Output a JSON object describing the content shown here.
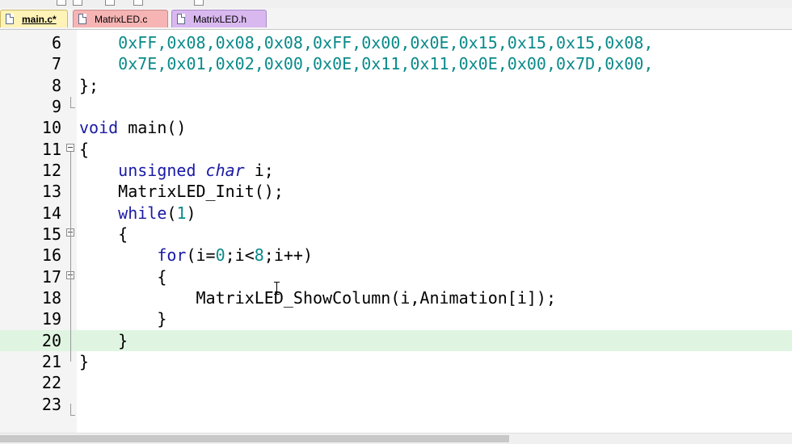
{
  "tabs": [
    {
      "label": "main.c*",
      "active": true,
      "color": "#fff3b8"
    },
    {
      "label": "MatrixLED.c",
      "active": false,
      "color": "#f6b4b4"
    },
    {
      "label": "MatrixLED.h",
      "active": false,
      "color": "#d9b8f0"
    }
  ],
  "editor": {
    "current_line": 20,
    "lines": [
      {
        "num": "6",
        "text": "    0xFF,0x08,0x08,0x08,0xFF,0x00,0x0E,0x15,0x15,0x15,0x08,"
      },
      {
        "num": "7",
        "text": "    0x7E,0x01,0x02,0x00,0x0E,0x11,0x11,0x0E,0x00,0x7D,0x00,"
      },
      {
        "num": "8",
        "text": "};"
      },
      {
        "num": "9",
        "text": ""
      },
      {
        "num": "10",
        "text": "void main()"
      },
      {
        "num": "11",
        "text": "{"
      },
      {
        "num": "12",
        "text": "    unsigned char i;"
      },
      {
        "num": "13",
        "text": "    MatrixLED_Init();"
      },
      {
        "num": "14",
        "text": "    while(1)"
      },
      {
        "num": "15",
        "text": "    {"
      },
      {
        "num": "16",
        "text": "        for(i=0;i<8;i++)"
      },
      {
        "num": "17",
        "text": "        {"
      },
      {
        "num": "18",
        "text": "            MatrixLED_ShowColumn(i,Animation[i]);"
      },
      {
        "num": "19",
        "text": "        }"
      },
      {
        "num": "20",
        "text": "    }"
      },
      {
        "num": "21",
        "text": "}"
      },
      {
        "num": "22",
        "text": ""
      },
      {
        "num": "23",
        "text": ""
      }
    ]
  },
  "colors": {
    "keyword": "#1a1aa6",
    "number": "#0a8a8a",
    "current_line_bg": "#dff5e2",
    "gutter_bg": "#f4f4f4"
  }
}
